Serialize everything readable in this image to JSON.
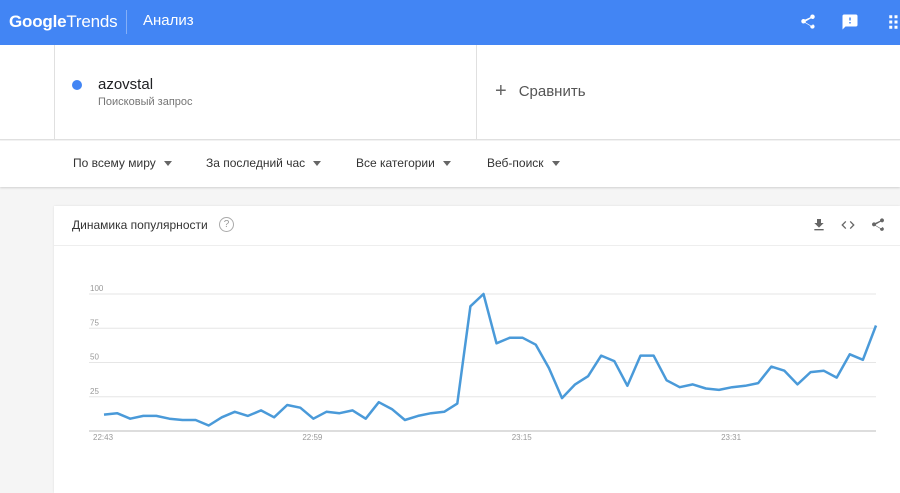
{
  "header": {
    "logo_google": "Google",
    "logo_trends": "Trends",
    "section_title": "Анализ",
    "icons": [
      "share-icon",
      "feedback-icon",
      "apps-icon"
    ]
  },
  "search_term": {
    "name": "azovstal",
    "type": "Поисковый запрос",
    "color": "#4285f4"
  },
  "compare": {
    "label": "Сравнить"
  },
  "filters": {
    "region": "По всему миру",
    "period": "За последний час",
    "category": "Все категории",
    "search_type": "Веб-поиск"
  },
  "card": {
    "title": "Динамика популярности",
    "help": "?",
    "icons": [
      "download-icon",
      "embed-icon",
      "share-icon"
    ]
  },
  "chart_data": {
    "type": "line",
    "series": [
      {
        "color": "#4a9ad9",
        "values": [
          12,
          13,
          9,
          11,
          11,
          9,
          8,
          8,
          4,
          10,
          14,
          11,
          15,
          10,
          19,
          17,
          9,
          14,
          13,
          15,
          9,
          21,
          16,
          8,
          11,
          13,
          14,
          20,
          91,
          100,
          64,
          68,
          68,
          63,
          46,
          24,
          34,
          40,
          55,
          51,
          33,
          55,
          55,
          37,
          32,
          34,
          31,
          30,
          32,
          33,
          35,
          47,
          44,
          34,
          43,
          44,
          39,
          56,
          52,
          77
        ]
      }
    ],
    "x_tick_labels": [
      "22:43",
      "22:59",
      "23:15",
      "23:31"
    ],
    "x_tick_index": [
      0,
      16,
      32,
      48
    ],
    "y_ticks": [
      25,
      50,
      75,
      100
    ],
    "ylim": [
      0,
      100
    ],
    "grid": true,
    "title": "",
    "xlabel": "",
    "ylabel": ""
  }
}
